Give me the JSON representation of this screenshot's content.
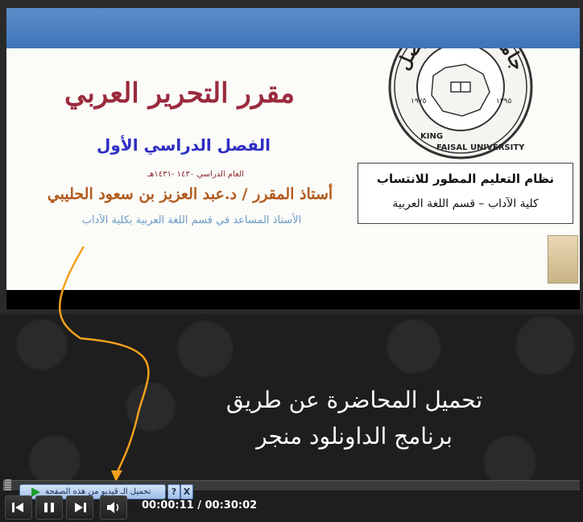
{
  "slide": {
    "course_title": "مقرر التحرير العربي",
    "semester": "الفصل الدراسي الأول",
    "academic_year": "العام الدراسي ١٤٣٠ -١٤٣١هـ",
    "instructor": "أستاذ المقرر / د.عبد العزيز بن سعود الحليبي",
    "position": "الأستاذ المساعد في قسم اللغة العربية بكلية الآداب",
    "info_box": {
      "line1": "نظام التعليم المطور للانتساب",
      "line2": "كلية الآداب – قسم اللغة العربية"
    },
    "logo": {
      "arabic_name": "جامعة الملك فيصل",
      "english_top": "KING",
      "english_bottom": "FAISAL UNIVERSITY",
      "year_left": "١٩٧٥",
      "year_right": "١٣٩٥"
    }
  },
  "caption": {
    "line1": "تحميل المحاضرة عن طريق",
    "line2": "برنامج الداونلود منجر"
  },
  "download_bar": {
    "label": "تحميل الـ ڤيديو من هذه الصفحة",
    "help": "?",
    "close": "X"
  },
  "player": {
    "current_time": "00:00:11",
    "total_time": "00:30:02",
    "time_separator": " / ",
    "progress_fraction": 0.006
  },
  "icons": {
    "rewind": "rewind-icon",
    "pause": "pause-icon",
    "forward": "forward-icon",
    "volume": "volume-icon"
  },
  "colors": {
    "title": "#9b2a3d",
    "semester": "#2e2fc2",
    "instructor": "#b35a1c",
    "arrow": "#f4a01c"
  }
}
